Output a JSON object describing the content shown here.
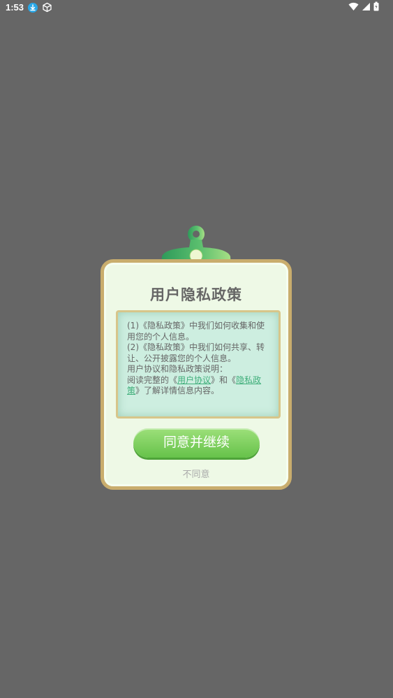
{
  "status_bar": {
    "time": "1:53",
    "icons": [
      "download-icon",
      "box-icon",
      "wifi-icon",
      "signal-icon",
      "battery-icon"
    ]
  },
  "dialog": {
    "title": "用户隐私政策",
    "content": {
      "line1_prefix": "(1)《隐私政策》中我们如何收集和使用您的个人信息。",
      "line2_prefix": "(2)《隐私政策》中我们如何共享、转让、公开披露您的个人信息。",
      "line3": "用户协议和隐私政策说明：",
      "line4_prefix": "阅读完整的《",
      "link_user_agreement": "用户协议",
      "line4_middle": "》和《",
      "link_privacy_policy": "隐私政策",
      "line4_suffix": "》了解详情信息内容。"
    },
    "agree_label": "同意并继续",
    "disagree_label": "不同意"
  },
  "colors": {
    "background": "#666666",
    "card_border": "#c9ad6d",
    "card_fill": "#eef9e6",
    "content_fill": "#cdeee0",
    "accent_green": "#66c24a",
    "link_green": "#3fae7a"
  }
}
